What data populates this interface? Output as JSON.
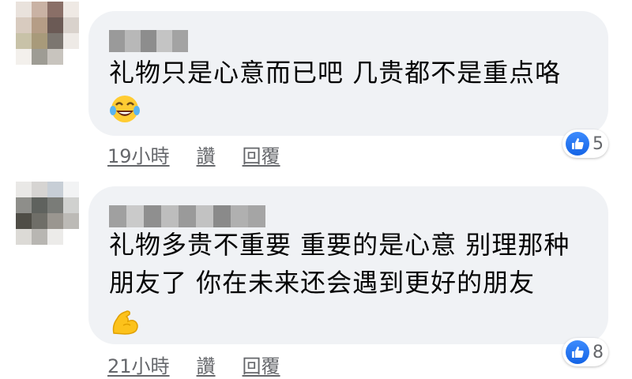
{
  "comments": [
    {
      "text": "礼物只是心意而已吧 几贵都不是重点咯",
      "emoji_icon": "face-with-tears-of-joy-icon",
      "time": "19小時",
      "like_label": "讚",
      "reply_label": "回覆",
      "reaction_icon": "like-icon",
      "reaction_count": "5"
    },
    {
      "text": "礼物多贵不重要 重要的是心意 别理那种朋友了 你在未来还会遇到更好的朋友",
      "emoji_icon": "flexed-biceps-icon",
      "time": "21小時",
      "like_label": "讚",
      "reply_label": "回覆",
      "reaction_icon": "like-icon",
      "reaction_count": "8"
    }
  ],
  "colors": {
    "bubble": "#f0f2f5",
    "meta_text": "#65676b",
    "like_blue": "#1877f2"
  }
}
